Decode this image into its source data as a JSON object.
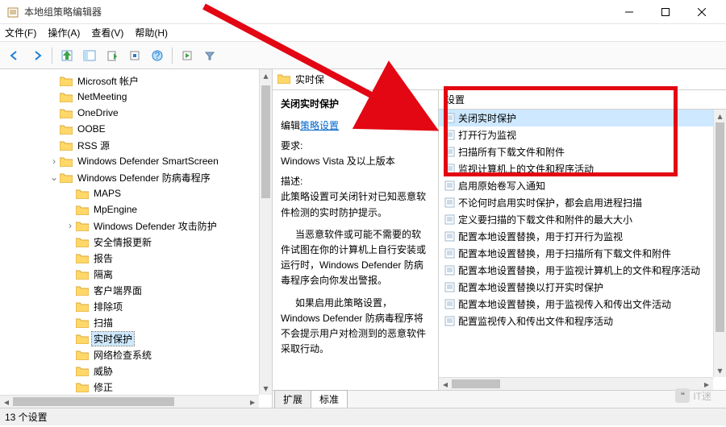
{
  "window": {
    "title": "本地组策略编辑器"
  },
  "menu": {
    "file": "文件(F)",
    "action": "操作(A)",
    "view": "查看(V)",
    "help": "帮助(H)"
  },
  "tree": [
    {
      "label": "Microsoft 帐户",
      "depth": 1
    },
    {
      "label": "NetMeeting",
      "depth": 1
    },
    {
      "label": "OneDrive",
      "depth": 1
    },
    {
      "label": "OOBE",
      "depth": 1
    },
    {
      "label": "RSS 源",
      "depth": 1
    },
    {
      "label": "Windows Defender SmartScreen",
      "depth": 1,
      "chev": "›"
    },
    {
      "label": "Windows Defender 防病毒程序",
      "depth": 1,
      "chev": "⌄"
    },
    {
      "label": "MAPS",
      "depth": 2
    },
    {
      "label": "MpEngine",
      "depth": 2
    },
    {
      "label": "Windows Defender 攻击防护",
      "depth": 2,
      "chev": "›"
    },
    {
      "label": "安全情报更新",
      "depth": 2
    },
    {
      "label": "报告",
      "depth": 2
    },
    {
      "label": "隔离",
      "depth": 2
    },
    {
      "label": "客户端界面",
      "depth": 2
    },
    {
      "label": "排除项",
      "depth": 2
    },
    {
      "label": "扫描",
      "depth": 2
    },
    {
      "label": "实时保护",
      "depth": 2,
      "sel": true
    },
    {
      "label": "网络检查系统",
      "depth": 2
    },
    {
      "label": "威胁",
      "depth": 2
    },
    {
      "label": "修正",
      "depth": 2
    }
  ],
  "path_header": "实时保",
  "desc": {
    "title": "关闭实时保护",
    "edit_prefix": "编辑",
    "edit_link": "策略设置",
    "req_label": "要求:",
    "req_text": "Windows Vista 及以上版本",
    "desc_label": "描述:",
    "p1": "此策略设置可关闭针对已知恶意软件检测的实时防护提示。",
    "p2": "当恶意软件或可能不需要的软件试图在你的计算机上自行安装或运行时，Windows Defender 防病毒程序会向你发出警报。",
    "p3": "如果启用此策略设置，Windows Defender 防病毒程序将不会提示用户对检测到的恶意软件采取行动。"
  },
  "list": {
    "header": "设置",
    "rows": [
      {
        "label": "关闭实时保护",
        "sel": true
      },
      {
        "label": "打开行为监视"
      },
      {
        "label": "扫描所有下载文件和附件"
      },
      {
        "label": "监视计算机上的文件和程序活动"
      },
      {
        "label": "启用原始卷写入通知"
      },
      {
        "label": "不论何时启用实时保护，都会启用进程扫描"
      },
      {
        "label": "定义要扫描的下载文件和附件的最大大小"
      },
      {
        "label": "配置本地设置替换，用于打开行为监视"
      },
      {
        "label": "配置本地设置替换，用于扫描所有下载文件和附件"
      },
      {
        "label": "配置本地设置替换，用于监视计算机上的文件和程序活动"
      },
      {
        "label": "配置本地设置替换以打开实时保护"
      },
      {
        "label": "配置本地设置替换，用于监视传入和传出文件活动"
      },
      {
        "label": "配置监视传入和传出文件和程序活动"
      }
    ]
  },
  "tabs": {
    "extended": "扩展",
    "standard": "标准"
  },
  "status": "13 个设置",
  "watermark": "IT迷"
}
